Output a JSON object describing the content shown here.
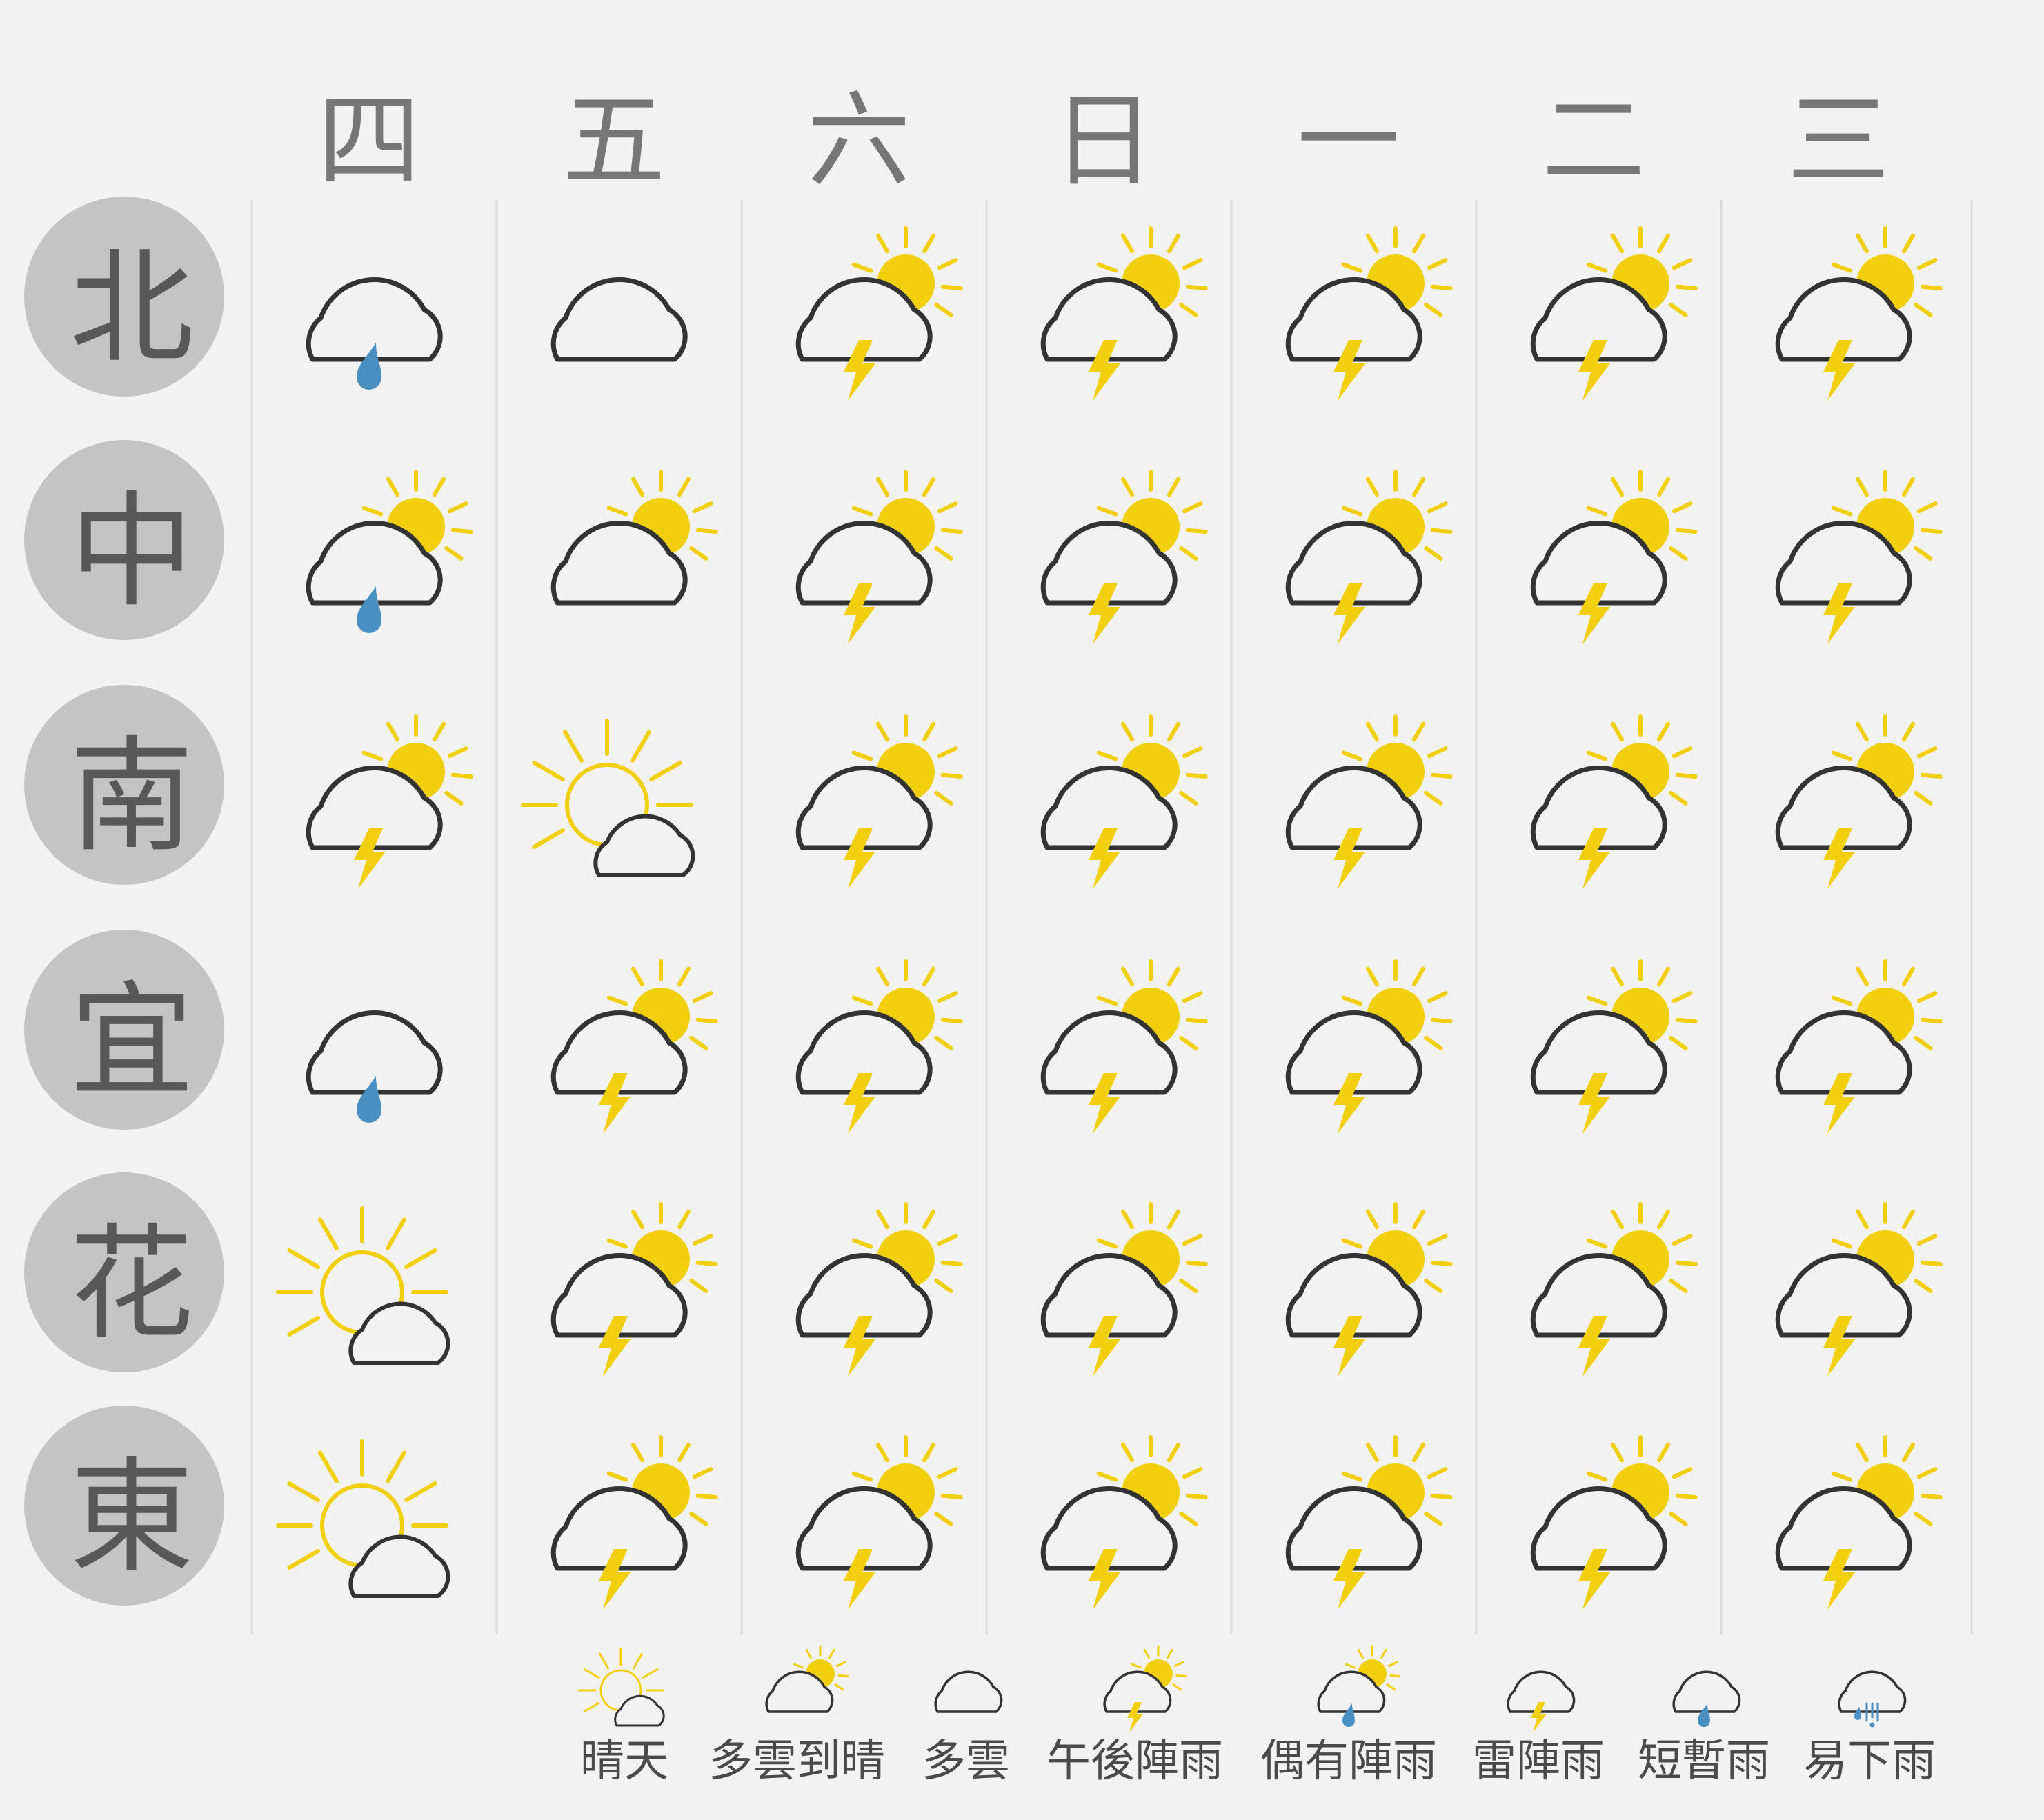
{
  "days": [
    "四",
    "五",
    "六",
    "日",
    "一",
    "二",
    "三"
  ],
  "regions": [
    {
      "label": "北",
      "forecast": [
        "rain",
        "cloudy",
        "pm-thunder",
        "pm-thunder",
        "pm-thunder",
        "pm-thunder",
        "pm-thunder"
      ]
    },
    {
      "label": "中",
      "forecast": [
        "occasional-rain",
        "cloudy-to-sunny",
        "pm-thunder",
        "pm-thunder",
        "pm-thunder",
        "pm-thunder",
        "pm-thunder"
      ]
    },
    {
      "label": "南",
      "forecast": [
        "pm-thunder",
        "sunny",
        "pm-thunder",
        "pm-thunder",
        "pm-thunder",
        "pm-thunder",
        "pm-thunder"
      ]
    },
    {
      "label": "宜",
      "forecast": [
        "rain",
        "pm-thunder",
        "pm-thunder",
        "pm-thunder",
        "pm-thunder",
        "pm-thunder",
        "pm-thunder"
      ]
    },
    {
      "label": "花",
      "forecast": [
        "sunny",
        "pm-thunder",
        "pm-thunder",
        "pm-thunder",
        "pm-thunder",
        "pm-thunder",
        "pm-thunder"
      ]
    },
    {
      "label": "東",
      "forecast": [
        "sunny",
        "pm-thunder",
        "pm-thunder",
        "pm-thunder",
        "pm-thunder",
        "pm-thunder",
        "pm-thunder"
      ]
    }
  ],
  "legend": [
    {
      "icon": "sunny",
      "label": "晴天"
    },
    {
      "icon": "cloudy-to-sunny",
      "label": "多雲到晴"
    },
    {
      "icon": "cloudy",
      "label": "多雲"
    },
    {
      "icon": "pm-thunder",
      "label": "午後陣雨"
    },
    {
      "icon": "occasional-rain",
      "label": "偶有陣雨"
    },
    {
      "icon": "thunder",
      "label": "雷陣雨"
    },
    {
      "icon": "rain",
      "label": "短暫雨"
    },
    {
      "icon": "heavy-rain",
      "label": "易下雨"
    }
  ],
  "colors": {
    "background": "#f2f2f2",
    "sun": "#f2cf0d",
    "rain": "#4a8fc2",
    "cloud_stroke": "#333333",
    "cloud_fill": "#f2f2f2",
    "day_text": "#777777",
    "region_circle": "#c4c4c4",
    "region_text": "#585858",
    "grid_line": "#d9d9d9",
    "legend_text": "#4a4a4a"
  }
}
